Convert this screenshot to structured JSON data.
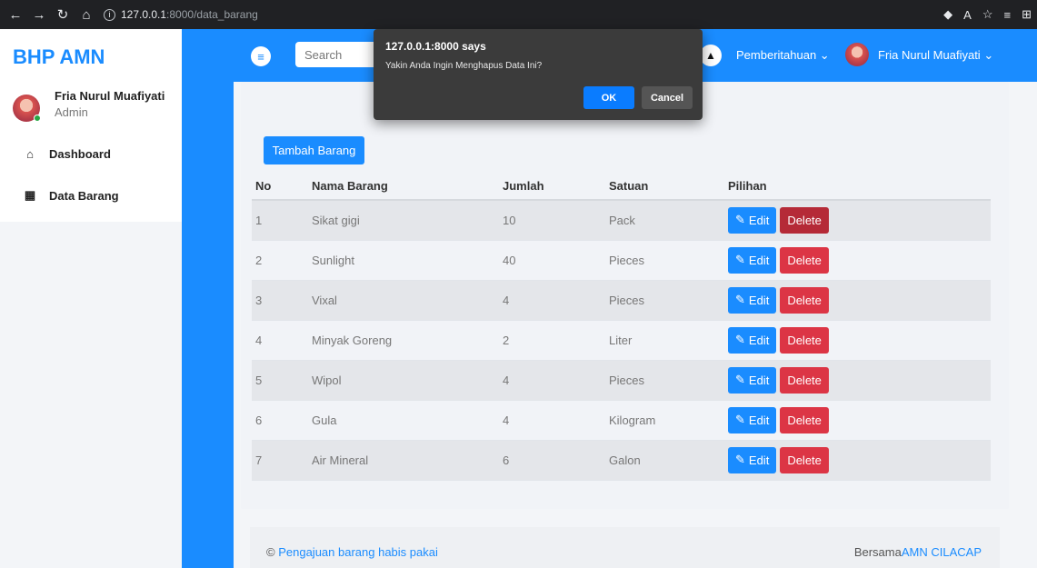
{
  "browser": {
    "url_host": "127.0.0.1",
    "url_path": ":8000/data_barang"
  },
  "sidebar": {
    "brand": "BHP AMN",
    "user_name": "Fria Nurul Muafiyati",
    "user_role": "Admin",
    "items": [
      {
        "label": "Dashboard",
        "icon": "home-icon"
      },
      {
        "label": "Data Barang",
        "icon": "grid-icon"
      }
    ]
  },
  "topbar": {
    "search_placeholder": "Search",
    "notifications_label": "Pemberitahuan",
    "user_name": "Fria Nurul Muafiyati"
  },
  "content": {
    "add_button": "Tambah Barang",
    "columns": [
      "No",
      "Nama Barang",
      "Jumlah",
      "Satuan",
      "Pilihan"
    ],
    "edit_label": "Edit",
    "delete_label": "Delete",
    "rows": [
      {
        "no": "1",
        "nama": "Sikat gigi",
        "jumlah": "10",
        "satuan": "Pack"
      },
      {
        "no": "2",
        "nama": "Sunlight",
        "jumlah": "40",
        "satuan": "Pieces"
      },
      {
        "no": "3",
        "nama": "Vixal",
        "jumlah": "4",
        "satuan": "Pieces"
      },
      {
        "no": "4",
        "nama": "Minyak Goreng",
        "jumlah": "2",
        "satuan": "Liter"
      },
      {
        "no": "5",
        "nama": "Wipol",
        "jumlah": "4",
        "satuan": "Pieces"
      },
      {
        "no": "6",
        "nama": "Gula",
        "jumlah": "4",
        "satuan": "Kilogram"
      },
      {
        "no": "7",
        "nama": "Air Mineral",
        "jumlah": "6",
        "satuan": "Galon"
      }
    ]
  },
  "footer": {
    "left_symbol": "©",
    "left_link": "Pengajuan barang habis pakai",
    "right_prefix": "Bersama",
    "right_link": "AMN CILACAP"
  },
  "dialog": {
    "title": "127.0.0.1:8000 says",
    "message": "Yakin Anda Ingin Menghapus Data Ini?",
    "ok_label": "OK",
    "cancel_label": "Cancel"
  },
  "colors": {
    "primary": "#1a8cff",
    "danger": "#dc3545"
  }
}
